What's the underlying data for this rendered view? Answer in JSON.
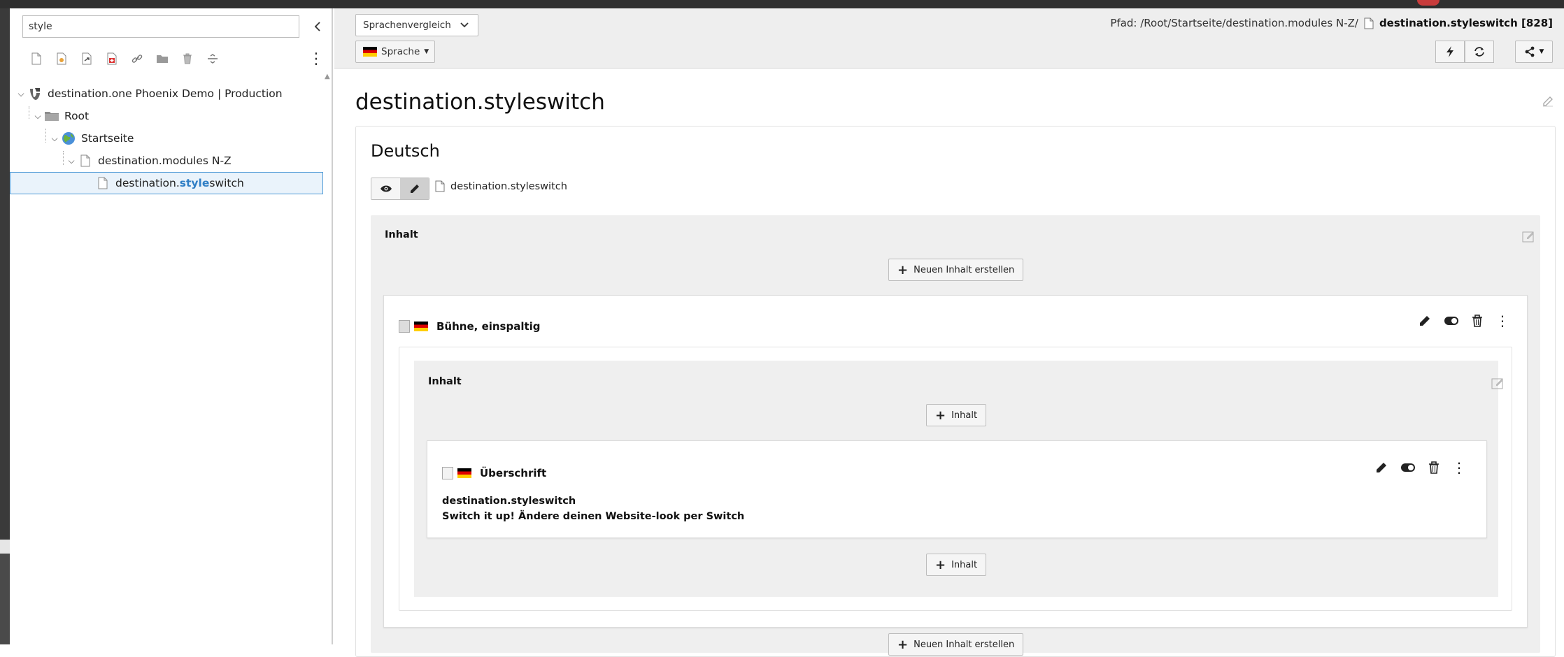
{
  "sidebar": {
    "search_value": "style",
    "tree": [
      {
        "label": "destination.one Phoenix Demo | Production"
      },
      {
        "label": "Root"
      },
      {
        "label": "Startseite"
      },
      {
        "label": "destination.modules N-Z"
      },
      {
        "label_pre": "destination.",
        "label_hl": "style",
        "label_post": "switch"
      }
    ]
  },
  "header": {
    "view_select": "Sprachenvergleich",
    "language_button": "Sprache",
    "path_prefix": "Pfad: /Root/Startseite/destination.modules N-Z/",
    "path_page": "destination.styleswitch [828]"
  },
  "main": {
    "page_title": "destination.styleswitch",
    "language_title": "Deutsch",
    "page_link": "destination.styleswitch",
    "colpos_title": "Inhalt",
    "new_content_label": "Neuen Inhalt erstellen",
    "element": {
      "title": "Bühne, einspaltig",
      "inner_colpos_title": "Inhalt",
      "inner_add_label": "Inhalt",
      "sub_element": {
        "title": "Überschrift",
        "line1": "destination.styleswitch",
        "line2": "Switch it up! Ändere deinen Website-look per Switch"
      }
    }
  },
  "colors": {
    "accent": "#2f7ec5",
    "header_bg": "#eeeeee",
    "colpos_bg": "#efefef",
    "selected_bg": "#eaf3fb"
  }
}
